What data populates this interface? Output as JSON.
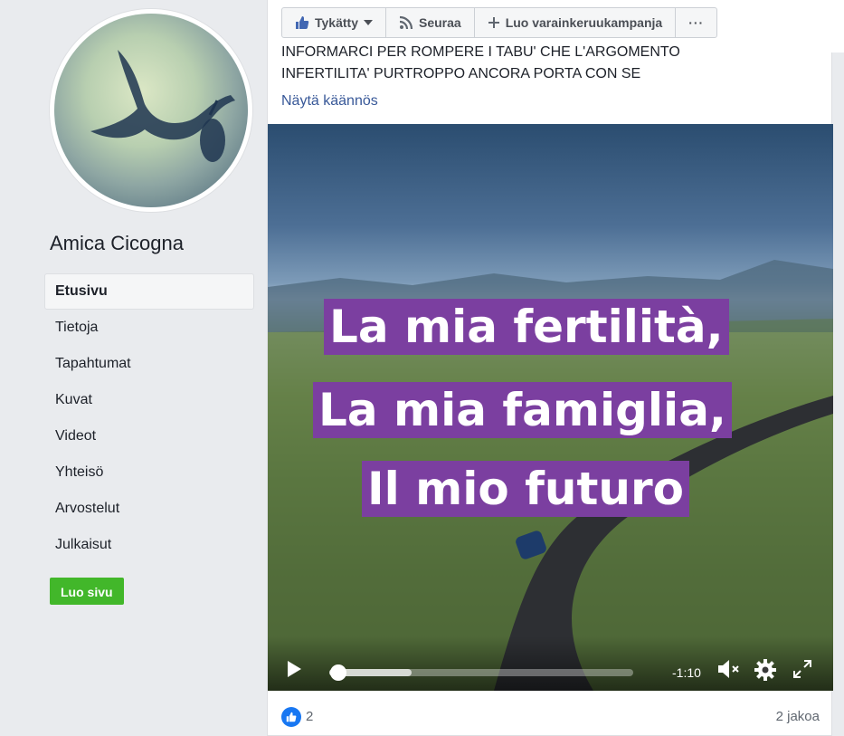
{
  "sidebar": {
    "page_name": "Amica Cicogna",
    "nav": [
      {
        "label": "Etusivu",
        "active": true
      },
      {
        "label": "Tietoja"
      },
      {
        "label": "Tapahtumat"
      },
      {
        "label": "Kuvat"
      },
      {
        "label": "Videot"
      },
      {
        "label": "Yhteisö"
      },
      {
        "label": "Arvostelut"
      },
      {
        "label": "Julkaisut"
      }
    ],
    "create_page": "Luo sivu"
  },
  "actionbar": {
    "liked": "Tykätty",
    "follow": "Seuraa",
    "fundraiser": "Luo varainkeruukampanja",
    "more": "···"
  },
  "post": {
    "text_line1": "INFORMARCI PER ROMPERE I TABU' CHE L'ARGOMENTO",
    "text_line2": "INFERTILITA' PURTROPPO ANCORA PORTA CON SE",
    "translate": "Näytä käännös",
    "video": {
      "caption": [
        "La mia fertilità,",
        "La mia famiglia,",
        "Il mio futuro"
      ],
      "time_remaining": "-1:10",
      "progress": 0.03,
      "buffered": 0.27
    },
    "likes": "2",
    "shares": "2 jakoa"
  },
  "colors": {
    "accent": "#385898",
    "create_green": "#42b72a",
    "caption_purple": "#7b3fa0",
    "like_blue": "#1877f2"
  }
}
